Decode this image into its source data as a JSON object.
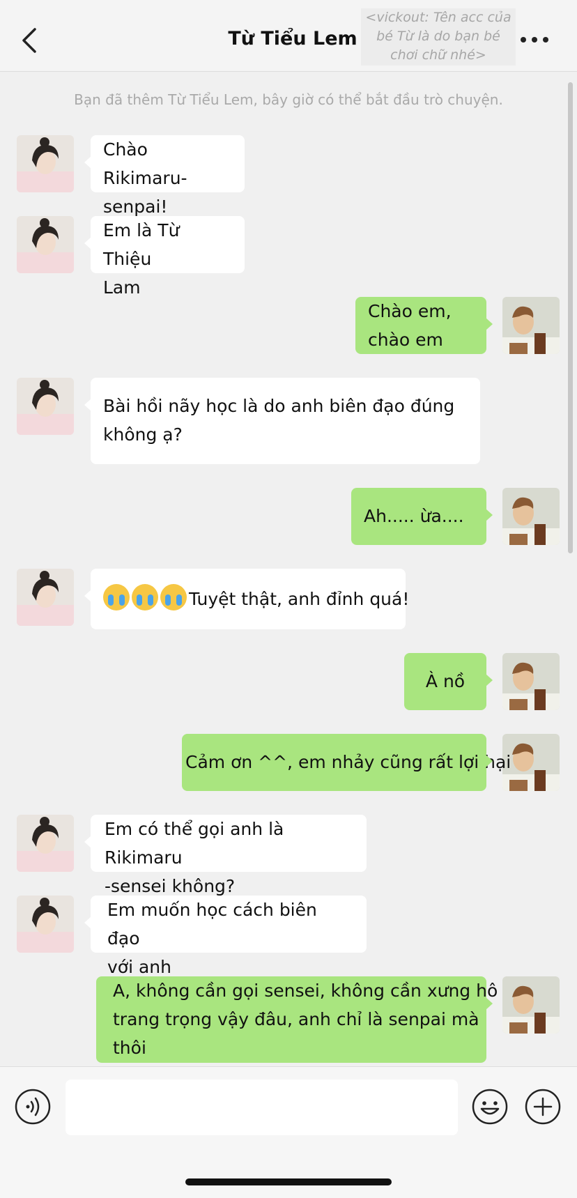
{
  "header": {
    "title": "Từ Tiểu Lem",
    "note": "<vickout: Tên acc của bé Từ là do bạn bé chơi chữ nhé>"
  },
  "system_message": "Bạn đã thêm Từ Tiểu Lem, bây giờ có thể bắt đầu trò chuyện.",
  "messages": [
    {
      "side": "in",
      "text": "Chào\nRikimaru-senpai!"
    },
    {
      "side": "in",
      "text": "Em là Từ Thiệu\nLam"
    },
    {
      "side": "out",
      "text": "Chào em,\nchào em"
    },
    {
      "side": "in",
      "text": "Bài hồi nãy học là do anh biên đạo đúng\nkhông ạ?"
    },
    {
      "side": "out",
      "text": "Ah..... ừa...."
    },
    {
      "side": "in",
      "emoji": "loudly-crying-face",
      "emoji_count": 3,
      "text": "Tuyệt thật, anh đỉnh quá!"
    },
    {
      "side": "out",
      "text": "À nồ"
    },
    {
      "side": "out",
      "text": "Cảm ơn ^^, em nhảy cũng rất lợi hại"
    },
    {
      "side": "in",
      "text": "Em có thể gọi anh là Rikimaru\n-sensei không?"
    },
    {
      "side": "in",
      "text": "Em muốn học cách biên đạo\nvới anh"
    },
    {
      "side": "out",
      "text": "A, không cần gọi sensei, không cần xưng hô\ntrang trọng vậy đâu, anh chỉ là senpai mà\nthôi"
    }
  ],
  "input": {
    "value": "",
    "placeholder": ""
  },
  "icons": {
    "back": "chevron-left-icon",
    "more": "more-dots-icon",
    "voice": "voice-icon",
    "emoji": "smiley-icon",
    "plus": "plus-icon"
  },
  "colors": {
    "incoming_bubble": "#ffffff",
    "outgoing_bubble": "#a9e57f",
    "background": "#f0f0f0"
  }
}
